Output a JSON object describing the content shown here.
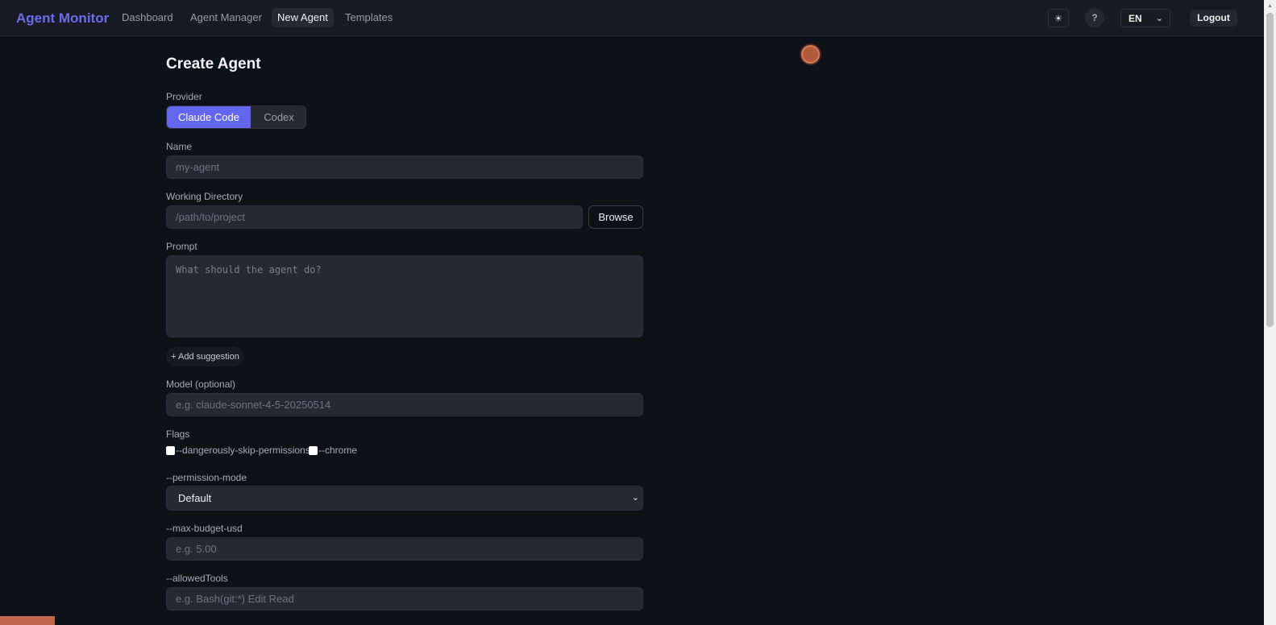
{
  "nav": {
    "brand": "Agent Monitor",
    "links": [
      "Dashboard",
      "Agent Manager",
      "New Agent",
      "Templates"
    ],
    "theme_icon": "☀",
    "help": "?",
    "lang": "EN",
    "logout": "Logout"
  },
  "form": {
    "title": "Create Agent",
    "provider_label": "Provider",
    "providers": [
      "Claude Code",
      "Codex"
    ],
    "name_label": "Name",
    "name_placeholder": "my-agent",
    "dir_label": "Working Directory",
    "dir_placeholder": "/path/to/project",
    "browse": "Browse",
    "prompt_label": "Prompt",
    "prompt_placeholder": "What should the agent do?",
    "add_suggestion": "+ Add suggestion",
    "model_label": "Model (optional)",
    "model_placeholder": "e.g. claude-sonnet-4-5-20250514",
    "flags_label": "Flags",
    "flags": [
      "--dangerously-skip-permissions",
      "--chrome"
    ],
    "permission_label": "--permission-mode",
    "permission_value": "Default",
    "budget_label": "--max-budget-usd",
    "budget_placeholder": "e.g. 5.00",
    "tools_label": "--allowedTools",
    "tools_placeholder": "e.g. Bash(git:*) Edit Read"
  }
}
